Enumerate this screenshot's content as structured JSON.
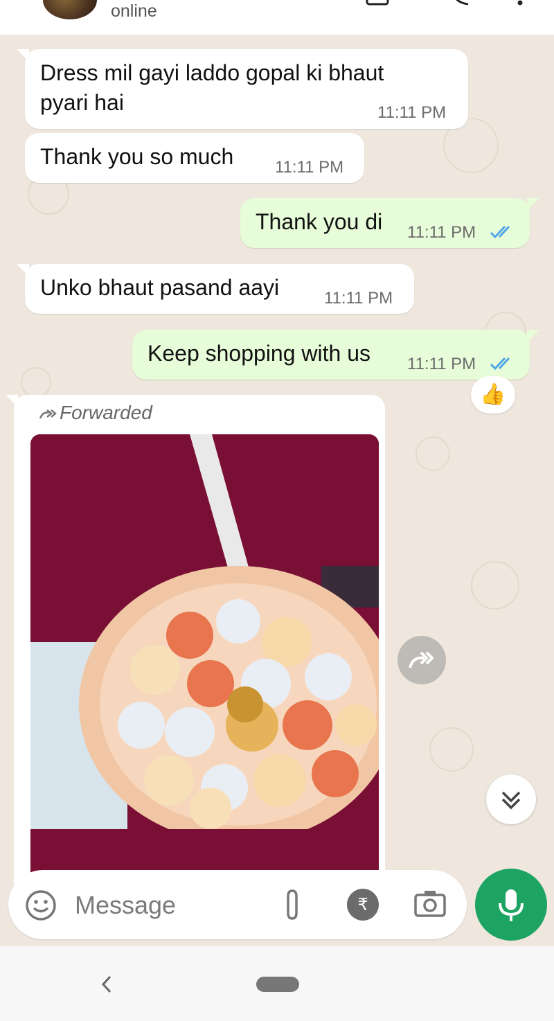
{
  "header": {
    "status": "online"
  },
  "messages": [
    {
      "direction": "incoming",
      "text_line1": "Dress mil gayi laddo gopal ki bhaut",
      "text_line2": "pyari hai",
      "time": "11:11 PM"
    },
    {
      "direction": "incoming",
      "text": "Thank you so much",
      "time": "11:11 PM"
    },
    {
      "direction": "outgoing",
      "text": "Thank you di",
      "time": "11:11 PM",
      "status": "read"
    },
    {
      "direction": "incoming",
      "text": "Unko bhaut pasand aayi",
      "time": "11:11 PM"
    },
    {
      "direction": "outgoing",
      "text": "Keep shopping with us",
      "time": "11:11 PM",
      "status": "read",
      "reaction": "👍"
    }
  ],
  "forwarded": {
    "label": "Forwarded",
    "media": "photo-flower-bouquet"
  },
  "composer": {
    "placeholder": "Message",
    "icons": [
      "emoji-icon",
      "attach-icon",
      "rupee-payment-icon",
      "camera-icon"
    ],
    "send_icon": "mic-icon"
  },
  "colors": {
    "chat_bg": "#efe7dd",
    "outgoing_bubble": "#e7fcd8",
    "incoming_bubble": "#ffffff",
    "read_ticks": "#4fa6e8",
    "mic_button": "#1da462"
  }
}
